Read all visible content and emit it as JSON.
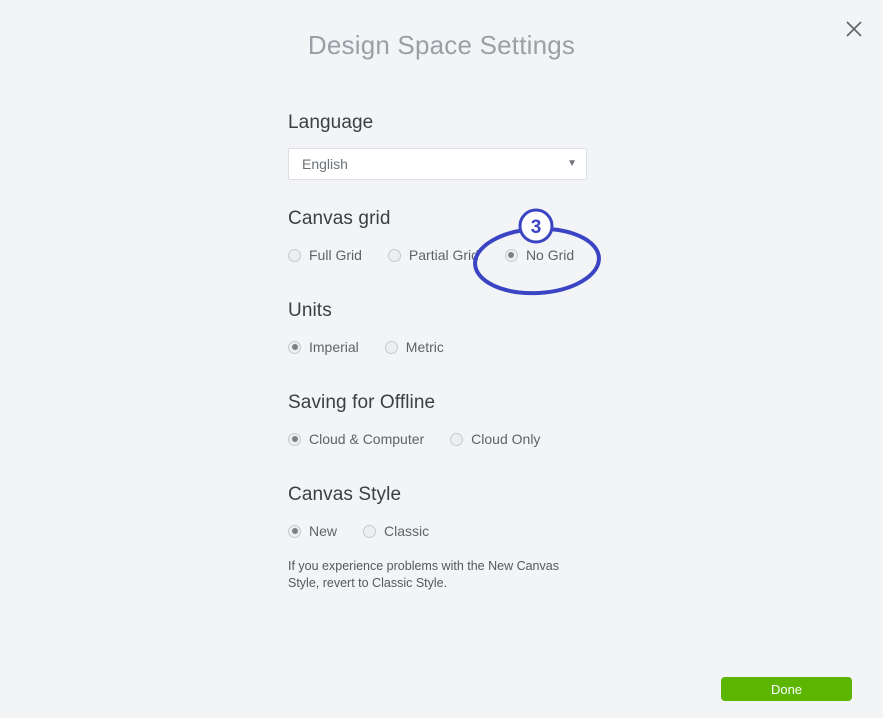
{
  "dialog": {
    "title": "Design Space Settings",
    "close_icon": "close-icon"
  },
  "language": {
    "heading": "Language",
    "selected": "English",
    "caret_icon": "chevron-down-icon",
    "options": [
      "English"
    ]
  },
  "canvas_grid": {
    "heading": "Canvas grid",
    "options": [
      {
        "label": "Full Grid",
        "checked": false
      },
      {
        "label": "Partial Grid",
        "checked": false
      },
      {
        "label": "No Grid",
        "checked": true
      }
    ]
  },
  "units": {
    "heading": "Units",
    "options": [
      {
        "label": "Imperial",
        "checked": true
      },
      {
        "label": "Metric",
        "checked": false
      }
    ]
  },
  "saving_offline": {
    "heading": "Saving for Offline",
    "options": [
      {
        "label": "Cloud & Computer",
        "checked": true
      },
      {
        "label": "Cloud Only",
        "checked": false
      }
    ]
  },
  "canvas_style": {
    "heading": "Canvas Style",
    "options": [
      {
        "label": "New",
        "checked": true
      },
      {
        "label": "Classic",
        "checked": false
      }
    ],
    "help_text": "If you experience problems with the New Canvas Style, revert to Classic Style."
  },
  "footer": {
    "done_label": "Done"
  },
  "annotation": {
    "step_number": "3",
    "color": "#3b45c4",
    "target": "No Grid"
  },
  "colors": {
    "background": "#f2f4f6",
    "title": "#9b9fa6",
    "heading": "#3c4043",
    "label": "#5f6368",
    "done_green": "#5cb500",
    "annotation_blue": "#3b45c4"
  }
}
